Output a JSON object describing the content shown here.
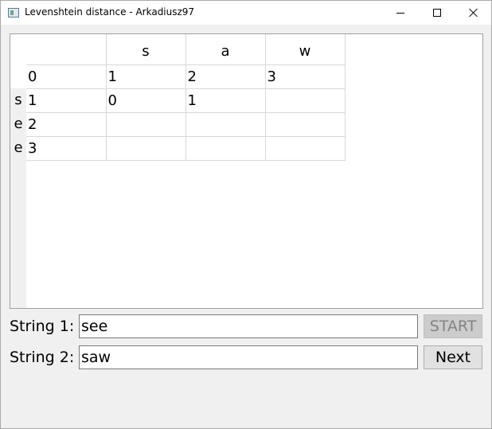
{
  "window": {
    "title": "Levenshtein distance - Arkadiusz97"
  },
  "table": {
    "column_headers": [
      "",
      "s",
      "a",
      "w"
    ],
    "row_headers": [
      "",
      "s",
      "e",
      "e"
    ],
    "rows": [
      [
        "0",
        "1",
        "2",
        "3"
      ],
      [
        "1",
        "0",
        "1",
        ""
      ],
      [
        "2",
        "",
        "",
        ""
      ],
      [
        "3",
        "",
        "",
        ""
      ]
    ]
  },
  "form": {
    "string1_label": "String 1:",
    "string1_value": "see",
    "string2_label": "String 2:",
    "string2_value": "saw",
    "start_label": "START",
    "next_label": "Next"
  }
}
